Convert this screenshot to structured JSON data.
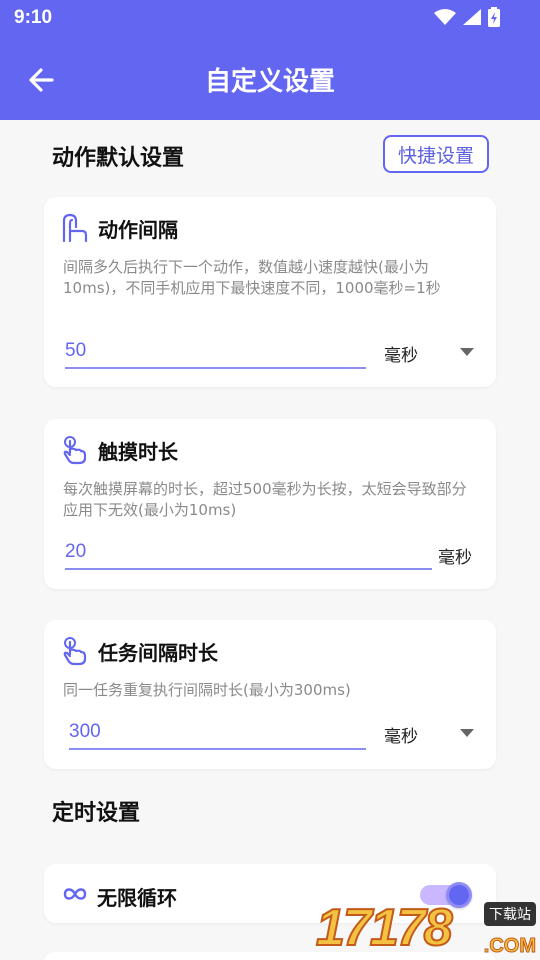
{
  "status_bar": {
    "time": "9:10",
    "icons": [
      "wifi-icon",
      "signal-icon",
      "battery-charging-icon"
    ]
  },
  "app_bar": {
    "title": "自定义设置",
    "back_icon": "arrow-left-icon"
  },
  "section_action": {
    "title": "动作默认设置",
    "quick_button": "快捷设置"
  },
  "cards": {
    "interval": {
      "title": "动作间隔",
      "icon": "touch-gesture-icon",
      "description": "间隔多久后执行下一个动作，数值越小速度越快(最小为10ms)，不同手机应用下最快速度不同，1000毫秒=1秒",
      "value": "50",
      "unit": "毫秒"
    },
    "touch": {
      "title": "触摸时长",
      "icon": "tap-hand-icon",
      "description": "每次触摸屏幕的时长，超过500毫秒为长按，太短会导致部分应用下无效(最小为10ms)",
      "value": "20",
      "unit": "毫秒"
    },
    "task": {
      "title": "任务间隔时长",
      "icon": "tap-hand-icon",
      "description": "同一任务重复执行间隔时长(最小为300ms)",
      "value": "300",
      "unit": "毫秒"
    }
  },
  "section_timer": {
    "title": "定时设置"
  },
  "loop": {
    "label": "无限循环",
    "icon": "infinity-icon",
    "enabled": true
  },
  "colors": {
    "accent": "#6366f1",
    "background": "#f7f7f7"
  },
  "watermark": {
    "number": "17178",
    "tag": "下载站",
    "suffix": ".COM"
  }
}
